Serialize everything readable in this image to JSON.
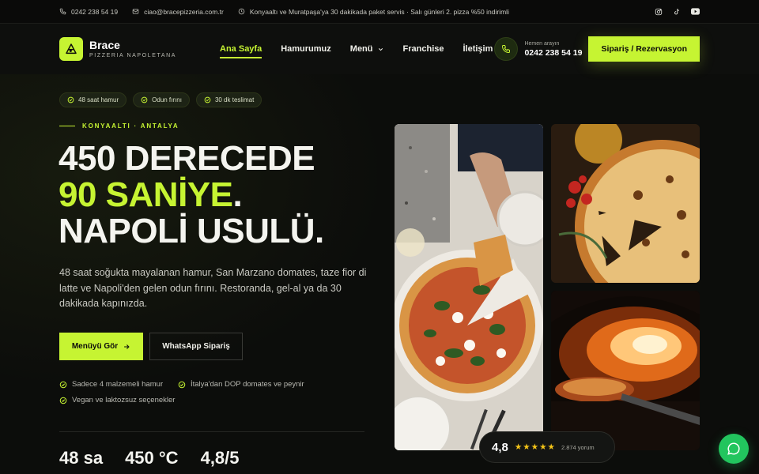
{
  "topbar": {
    "phone": "0242 238 54 19",
    "email": "ciao@bracepizzeria.com.tr",
    "announcement": "Konyaaltı ve Muratpaşa'ya 30 dakikada paket servis · Salı günleri 2. pizza %50 indirimli",
    "social": [
      "instagram-icon",
      "tiktok-icon",
      "youtube-icon"
    ]
  },
  "brand": {
    "name": "Brace",
    "tagline": "PIZZERIA NAPOLETANA",
    "accent_color": "#c6f432"
  },
  "nav": {
    "items": [
      {
        "label": "Ana Sayfa",
        "active": true
      },
      {
        "label": "Hamurumuz",
        "active": false
      },
      {
        "label": "Menü",
        "active": false,
        "dropdown": true
      },
      {
        "label": "Franchise",
        "active": false
      },
      {
        "label": "İletişim",
        "active": false
      }
    ],
    "call_label": "Hemen arayın",
    "call_number": "0242 238 54 19",
    "cta_label": "Sipariş / Rezervasyon"
  },
  "hero": {
    "chips": [
      "48 saat hamur",
      "Odun fırını",
      "30 dk teslimat"
    ],
    "eyebrow": "KONYAALTI · ANTALYA",
    "headline_line1": "450 DERECEDE",
    "headline_accent": "90 SANİYE",
    "headline_dot": ".",
    "headline_line3": "NAPOLİ USULÜ.",
    "lead": "48 saat soğukta mayalanan hamur, San Marzano domates, taze fior di latte ve Napoli'den gelen odun fırını. Restoranda, gel-al ya da 30 dakikada kapınızda.",
    "primary_button": "Menüyü Gör",
    "secondary_button": "WhatsApp Sipariş",
    "features": [
      "Sadece 4 malzemeli hamur",
      "İtalya'dan DOP domates ve peynir",
      "Vegan ve laktozsuz seçenekler"
    ],
    "stats": [
      "48 sa",
      "450 °C",
      "4,8/5"
    ]
  },
  "rating": {
    "score": "4,8",
    "stars": "★★★★★",
    "reviews": "2.874 yorum"
  },
  "chat": {
    "icon": "chat-bubble-icon",
    "color": "#22c55e"
  }
}
